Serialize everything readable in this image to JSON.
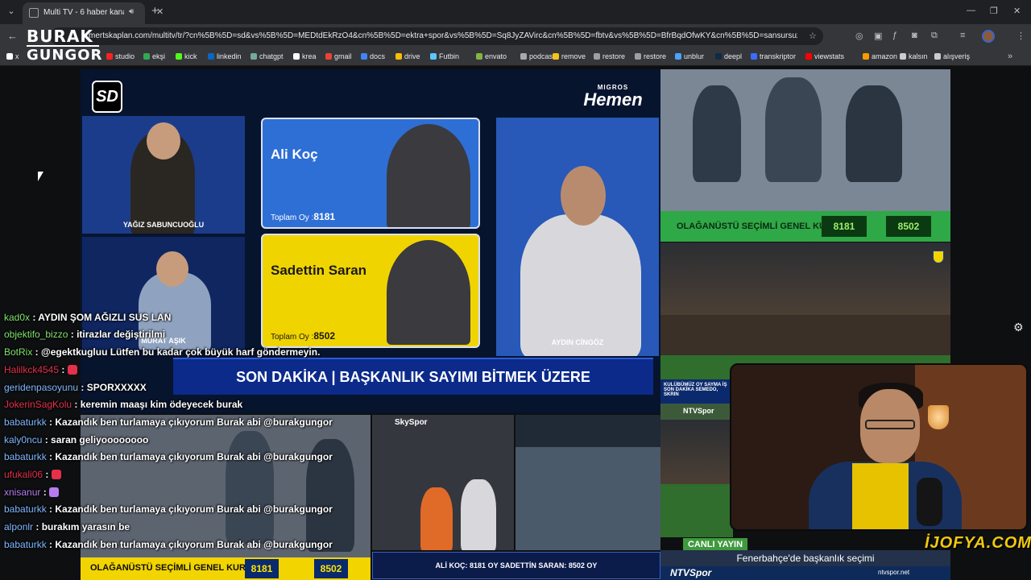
{
  "browser": {
    "tab_title": "Multi TV - 6 haber kanalını",
    "url": "mertskaplan.com/multitv/tr/?cn%5B%5D=sd&vs%5B%5D=MEDtdEkRzO4&cn%5B%5D=ektra+spor&vs%5B%5D=Sq8JyZAVirc&cn%5B%5D=fbtv&vs%5B%5D=BfrBqdOfwKY&cn%5B%5D=sansursuz&vs%5B%5D...",
    "bookmarks": [
      "x",
      "studio",
      "ekşi",
      "kick",
      "linkedin",
      "chatgpt",
      "krea",
      "gmail",
      "docs",
      "drive",
      "Futbin",
      "envato",
      "podcast",
      "remove",
      "restore",
      "restore",
      "unblur",
      "deepl",
      "transkriptor",
      "viewstats",
      "amazon",
      "kalsın",
      "alışveriş"
    ],
    "bookmark_colors": [
      "#ffffff",
      "#ff2020",
      "#34a853",
      "#53fc18",
      "#0a66c2",
      "#74aa9c",
      "#ffffff",
      "#ea4335",
      "#4285f4",
      "#fbbc04",
      "#5ac8ff",
      "#82b541",
      "#aaaaaa",
      "#f5c518",
      "#9aa0a6",
      "#9aa0a6",
      "#4aa3ff",
      "#0f2b46",
      "#3b6cff",
      "#ff0000",
      "#ff9900",
      "#cccccc",
      "#cccccc"
    ]
  },
  "overlay_logo": {
    "line1": "BURAK",
    "line2": "GUNGOR"
  },
  "tv": {
    "channel": "SD",
    "sponsor_small": "MIGROS",
    "sponsor_big": "Hemen",
    "host_top": "YAĞIZ SABUNCUOĞLU",
    "host_bottom": "MURAT AŞIK",
    "guest": "AYDIN CİNGÖZ",
    "candidate1": {
      "name": "Ali Koç",
      "votes_label": "Toplam Oy :",
      "votes": "8181"
    },
    "candidate2": {
      "name": "Sadettin Saran",
      "votes_label": "Toplam Oy :",
      "votes": "8502"
    },
    "breaking": "SON DAKİKA | BAŞKANLIK SAYIMI BİTMEK ÜZERE"
  },
  "right_panel": {
    "banner": "OLAĞANÜSTÜ SEÇİMLİ GENEL KURUL",
    "vote1": "8181",
    "vote2": "8502",
    "club_strip": "KULÜBÜMÜZ OY SAYMA İŞ",
    "news_strip": "SON DAKİKA SEMEDO, SKRIN",
    "ntv_small": "NTVSpor"
  },
  "bottom": {
    "banner": "OLAĞANÜSTÜ SEÇİMLİ GENEL KURUL",
    "vote1": "8181",
    "vote2": "8502",
    "skyspor": "SkySpor",
    "ticker": "ALİ KOÇ: 8181 OY SADETTİN SARAN: 8502 OY"
  },
  "live": {
    "badge": "CANLI YAYIN",
    "caption": "Fenerbahçe'de başkanlık seçimi",
    "channel": "NTVSpor",
    "url": "ntvspor.net",
    "watermark": "İJOFYA.COM"
  },
  "chat": [
    {
      "user": "kad0x",
      "msg": "AYDIN ŞOM AĞIZLI SUS LAN",
      "color": "#7fe36b"
    },
    {
      "user": "objektifo_bizzo",
      "msg": "itirazlar değiştirilmi",
      "color": "#7fe36b"
    },
    {
      "user": "BotRix",
      "msg": "@egektkugluu Lütfen bu kadar çok büyük harf göndermeyin.",
      "color": "#7fe36b"
    },
    {
      "user": "Halilkck4545",
      "msg": "",
      "color": "#e5304b"
    },
    {
      "user": "geridenpasoyunu",
      "msg": "SPORXXXXX",
      "color": "#7fb8ff"
    },
    {
      "user": "JokerinSagKolu",
      "msg": "keremin maaşı kim ödeyecek burak",
      "color": "#e5304b"
    },
    {
      "user": "babaturkk",
      "msg": "Kazandık ben turlamaya çıkıyorum Burak abi @burakgungor",
      "color": "#7fb8ff"
    },
    {
      "user": "kaly0ncu",
      "msg": "saran geliyoooooooo",
      "color": "#7fb8ff"
    },
    {
      "user": "babaturkk",
      "msg": "Kazandık ben turlamaya çıkıyorum Burak abi @burakgungor",
      "color": "#7fb8ff"
    },
    {
      "user": "ufukali06",
      "msg": "",
      "color": "#e5304b"
    },
    {
      "user": "xnisanur",
      "msg": "",
      "color": "#b77cf2"
    },
    {
      "user": "babaturkk",
      "msg": "Kazandık ben turlamaya çıkıyorum Burak abi @burakgungor",
      "color": "#7fb8ff"
    },
    {
      "user": "alponlr",
      "msg": "burakım yarasın be",
      "color": "#7fb8ff"
    },
    {
      "user": "babaturkk",
      "msg": "Kazandık ben turlamaya çıkıyorum Burak abi @burakgungor",
      "color": "#7fb8ff"
    }
  ]
}
